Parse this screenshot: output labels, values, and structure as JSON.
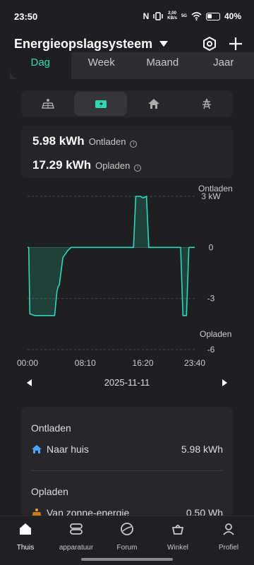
{
  "status": {
    "time": "23:50",
    "network_speed_value": "2,00",
    "network_speed_unit": "KB/s",
    "network_type": "5G",
    "battery": "40%"
  },
  "header": {
    "title": "Energieopslagsysteem"
  },
  "tabs": [
    "Dag",
    "Week",
    "Maand",
    "Jaar"
  ],
  "icon_tabs": [
    "solar-panel-icon",
    "battery-charge-icon",
    "home-icon",
    "grid-tower-icon"
  ],
  "summary": {
    "discharge_value": "5.98 kWh",
    "discharge_label": "Ontladen",
    "charge_value": "17.29 kWh",
    "charge_label": "Opladen"
  },
  "chart_data": {
    "type": "line",
    "top_label": "Ontladen",
    "bottom_label": "Opladen",
    "y_ticks": [
      "3 kW",
      "0",
      "-3",
      "-6"
    ],
    "ylim": [
      -6,
      3
    ],
    "x_ticks": [
      "00:00",
      "08:10",
      "16:20",
      "23:40"
    ],
    "x": [
      "00:00",
      "00:10",
      "00:20",
      "01:00",
      "02:40",
      "03:50",
      "04:10",
      "04:20",
      "04:30",
      "05:00",
      "05:40",
      "06:10",
      "15:00",
      "15:20",
      "16:00",
      "16:20",
      "16:50",
      "17:10",
      "21:20",
      "21:40",
      "22:00",
      "22:30",
      "22:50",
      "23:00",
      "23:40"
    ],
    "values": [
      0,
      0,
      -3.9,
      -4,
      -4,
      -4,
      -2.6,
      -2.3,
      -2.2,
      -0.6,
      -0.2,
      0,
      0,
      3,
      3,
      2.9,
      3,
      0,
      0,
      0,
      -4,
      -4,
      0,
      0,
      0
    ],
    "color": "#2fd9b4"
  },
  "date": {
    "label": "2025-11-11"
  },
  "details": {
    "discharge_title": "Ontladen",
    "to_home_label": "Naar huis",
    "to_home_value": "5.98 kWh",
    "charge_title": "Opladen",
    "from_solar_label": "Van zonne-energie",
    "from_solar_value": "0.50 Wh"
  },
  "nav": [
    {
      "label": "Thuis",
      "icon": "home-icon"
    },
    {
      "label": "apparatuur",
      "icon": "device-icon"
    },
    {
      "label": "Forum",
      "icon": "globe-icon"
    },
    {
      "label": "Winkel",
      "icon": "shop-basket-icon"
    },
    {
      "label": "Profiel",
      "icon": "profile-icon"
    }
  ]
}
